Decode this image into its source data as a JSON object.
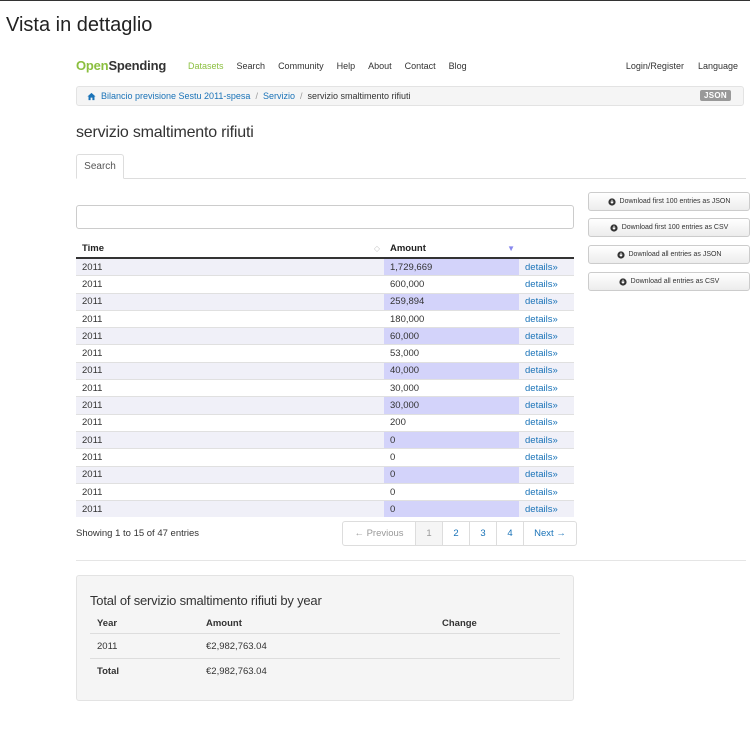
{
  "page": {
    "heading": "Vista in dettaglio"
  },
  "nav": {
    "brand_part1": "Open",
    "brand_part2": "Spending",
    "links": [
      "Datasets",
      "Search",
      "Community",
      "Help",
      "About",
      "Contact",
      "Blog"
    ],
    "right_links": [
      "Login/Register",
      "Language"
    ]
  },
  "breadcrumb": {
    "items": [
      "Bilancio previsione Sestu 2011-spesa",
      "Servizio",
      "servizio smaltimento rifiuti"
    ],
    "separator": "/",
    "badge": "JSON"
  },
  "section": {
    "title": "servizio smaltimento rifiuti"
  },
  "tabs": {
    "search": "Search"
  },
  "filter": {
    "value": "",
    "placeholder": ""
  },
  "downloads": [
    "Download first 100 entries as JSON",
    "Download first 100 entries as CSV",
    "Download all entries as JSON",
    "Download all entries as CSV"
  ],
  "table": {
    "columns": [
      "Time",
      "Amount",
      ""
    ],
    "rows": [
      {
        "time": "2011",
        "amount": "1,729,669",
        "link": "details»"
      },
      {
        "time": "2011",
        "amount": "600,000",
        "link": "details»"
      },
      {
        "time": "2011",
        "amount": "259,894",
        "link": "details»"
      },
      {
        "time": "2011",
        "amount": "180,000",
        "link": "details»"
      },
      {
        "time": "2011",
        "amount": "60,000",
        "link": "details»"
      },
      {
        "time": "2011",
        "amount": "53,000",
        "link": "details»"
      },
      {
        "time": "2011",
        "amount": "40,000",
        "link": "details»"
      },
      {
        "time": "2011",
        "amount": "30,000",
        "link": "details»"
      },
      {
        "time": "2011",
        "amount": "30,000",
        "link": "details»"
      },
      {
        "time": "2011",
        "amount": "200",
        "link": "details»"
      },
      {
        "time": "2011",
        "amount": "0",
        "link": "details»"
      },
      {
        "time": "2011",
        "amount": "0",
        "link": "details»"
      },
      {
        "time": "2011",
        "amount": "0",
        "link": "details»"
      },
      {
        "time": "2011",
        "amount": "0",
        "link": "details»"
      },
      {
        "time": "2011",
        "amount": "0",
        "link": "details»"
      }
    ]
  },
  "pagination": {
    "info": "Showing 1 to 15 of 47 entries",
    "previous": "← Previous",
    "pages": [
      "1",
      "2",
      "3",
      "4"
    ],
    "next": "Next →"
  },
  "totals": {
    "title": "Total of servizio smaltimento rifiuti by year",
    "columns": [
      "Year",
      "Amount",
      "Change"
    ],
    "rows": [
      {
        "year": "2011",
        "amount": "€2,982,763.04",
        "change": ""
      },
      {
        "year": "Total",
        "amount": "€2,982,763.04",
        "change": ""
      }
    ]
  },
  "colors": {
    "brand_green": "#8bbf3f",
    "link_blue": "#1a73b8",
    "amount_highlight": "#d3d3fa"
  }
}
